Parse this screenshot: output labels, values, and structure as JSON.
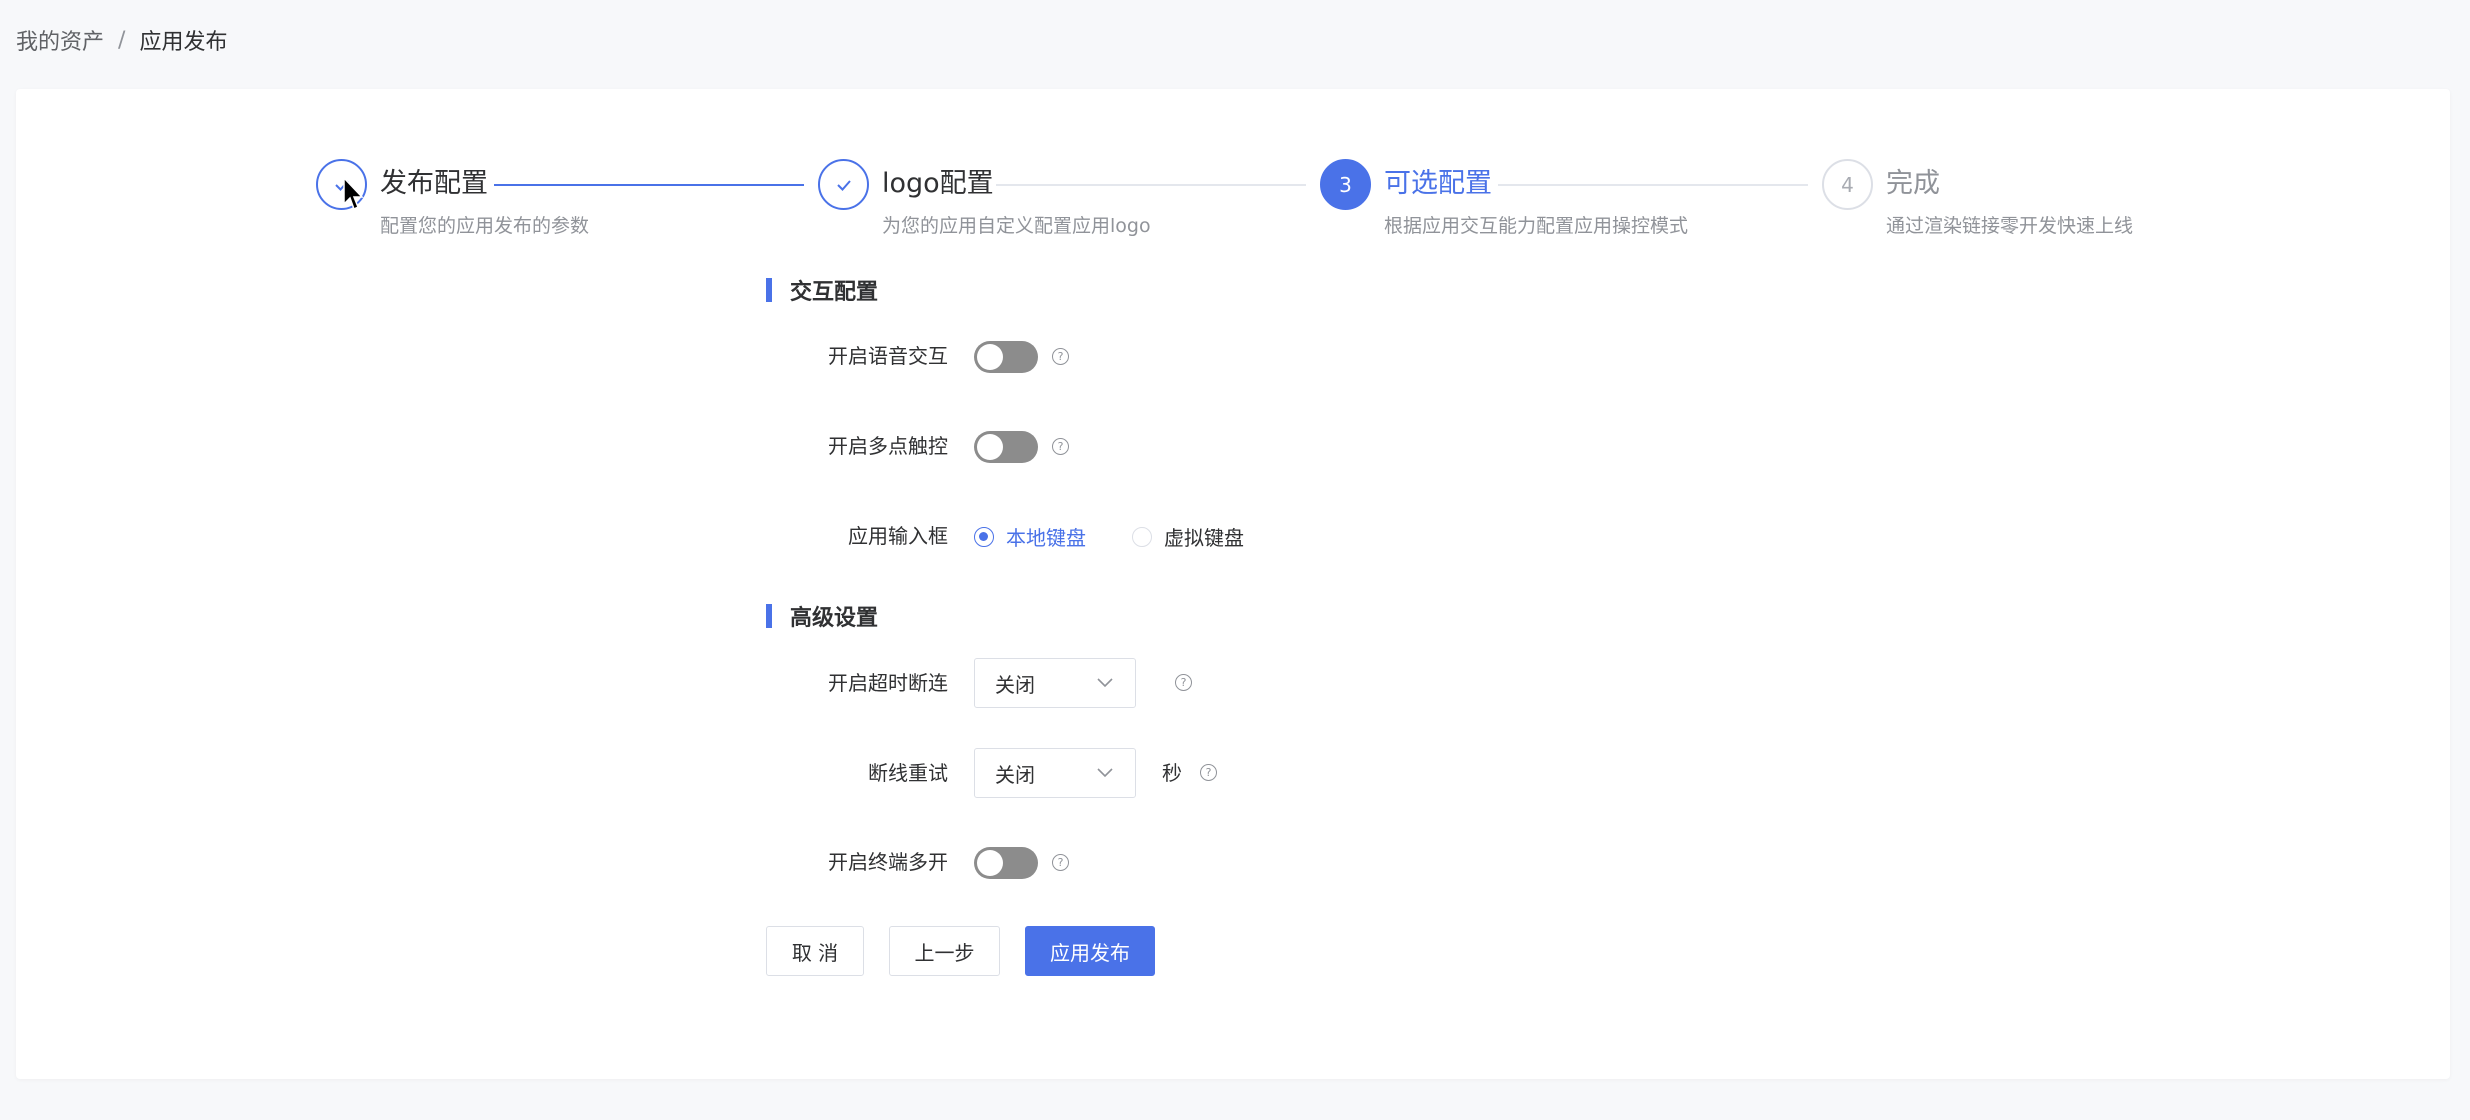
{
  "breadcrumb": {
    "parent": "我的资产",
    "separator": "/",
    "current": "应用发布"
  },
  "steps": [
    {
      "index": "1",
      "title": "发布配置",
      "desc": "配置您的应用发布的参数",
      "status": "done"
    },
    {
      "index": "2",
      "title": "logo配置",
      "desc": "为您的应用自定义配置应用logo",
      "status": "done"
    },
    {
      "index": "3",
      "title": "可选配置",
      "desc": "根据应用交互能力配置应用操控模式",
      "status": "active"
    },
    {
      "index": "4",
      "title": "完成",
      "desc": "通过渲染链接零开发快速上线",
      "status": "wait"
    }
  ],
  "interaction": {
    "title": "交互配置",
    "voice_label": "开启语音交互",
    "voice_on": false,
    "multitouch_label": "开启多点触控",
    "multitouch_on": false,
    "input_label": "应用输入框",
    "input_options": [
      "本地键盘",
      "虚拟键盘"
    ],
    "input_selected": "本地键盘"
  },
  "advanced": {
    "title": "高级设置",
    "timeout_label": "开启超时断连",
    "timeout_value": "关闭",
    "retry_label": "断线重试",
    "retry_value": "关闭",
    "retry_unit": "秒",
    "multiterm_label": "开启终端多开",
    "multiterm_on": false
  },
  "actions": {
    "cancel": "取 消",
    "prev": "上一步",
    "publish": "应用发布"
  },
  "colors": {
    "primary": "#4a72e8",
    "switch_off": "#8c8c8c",
    "border": "#dcdfe6"
  }
}
